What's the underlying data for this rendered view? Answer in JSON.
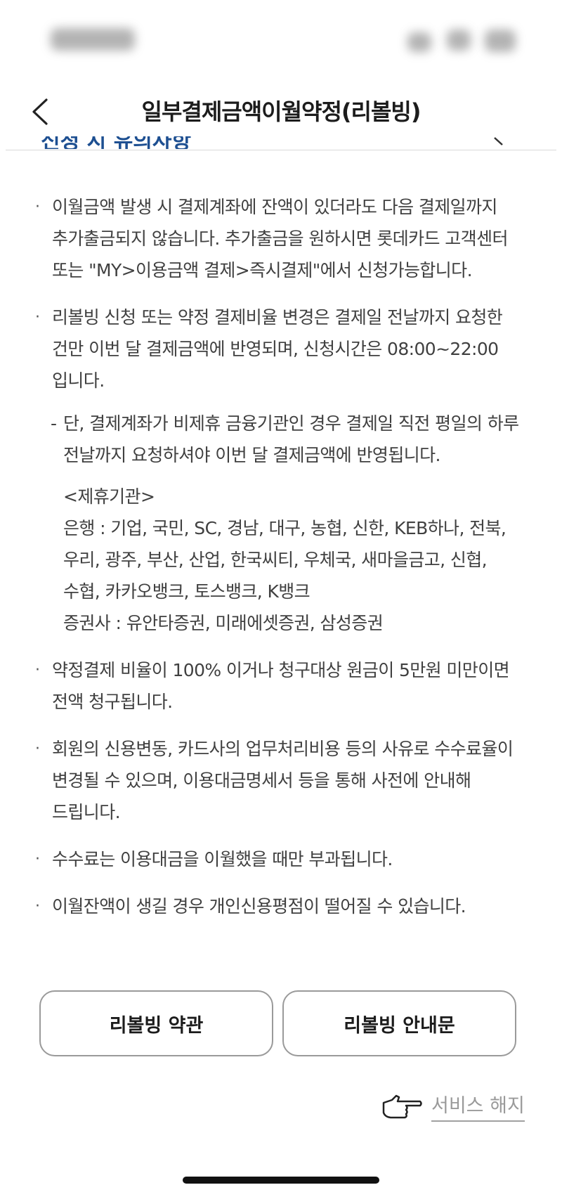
{
  "header": {
    "title": "일부결제금액이월약정(리볼빙)"
  },
  "notes": [
    {
      "text": "이월금액 발생 시 결제계좌에 잔액이 있더라도 다음 결제일까지 추가출금되지 않습니다. 추가출금을 원하시면 롯데카드 고객센터 또는 \"MY>이용금액 결제>즉시결제\"에서 신청가능합니다."
    },
    {
      "text": "리볼빙 신청 또는 약정 결제비율 변경은 결제일 전날까지 요청한 건만 이번 달 결제금액에 반영되며, 신청시간은 08:00~22:00 입니다."
    },
    {
      "text": "약정결제 비율이 100% 이거나 청구대상 원금이 5만원 미만이면 전액 청구됩니다."
    },
    {
      "text": "회원의 신용변동, 카드사의 업무처리비용 등의 사유로 수수료율이 변경될 수 있으며, 이용대금명세서 등을 통해 사전에 안내해 드립니다."
    },
    {
      "text": "수수료는 이용대금을 이월했을 때만 부과됩니다."
    },
    {
      "text": "이월잔액이 생길 경우 개인신용평점이 떨어질 수 있습니다."
    }
  ],
  "sub_note": "단, 결제계좌가 비제휴 금융기관인 경우 결제일 직전 평일의 하루 전날까지 요청하셔야 이번 달 결제금액에 반영됩니다.",
  "partners": {
    "heading": "<제휴기관>",
    "banks": "은행 : 기업, 국민, SC, 경남, 대구, 농협, 신한, KEB하나, 전북, 우리, 광주, 부산, 산업, 한국씨티, 우체국, 새마을금고, 신협, 수협, 카카오뱅크, 토스뱅크, K뱅크",
    "securities": "증권사 : 유안타증권, 미래에셋증권, 삼성증권"
  },
  "buttons": {
    "terms": "리볼빙 약관",
    "guide": "리볼빙 안내문"
  },
  "cancel": {
    "label": "서비스 해지",
    "icon": "pointing-hand-icon"
  },
  "cut_off_heading": "신청 시 유의사항"
}
